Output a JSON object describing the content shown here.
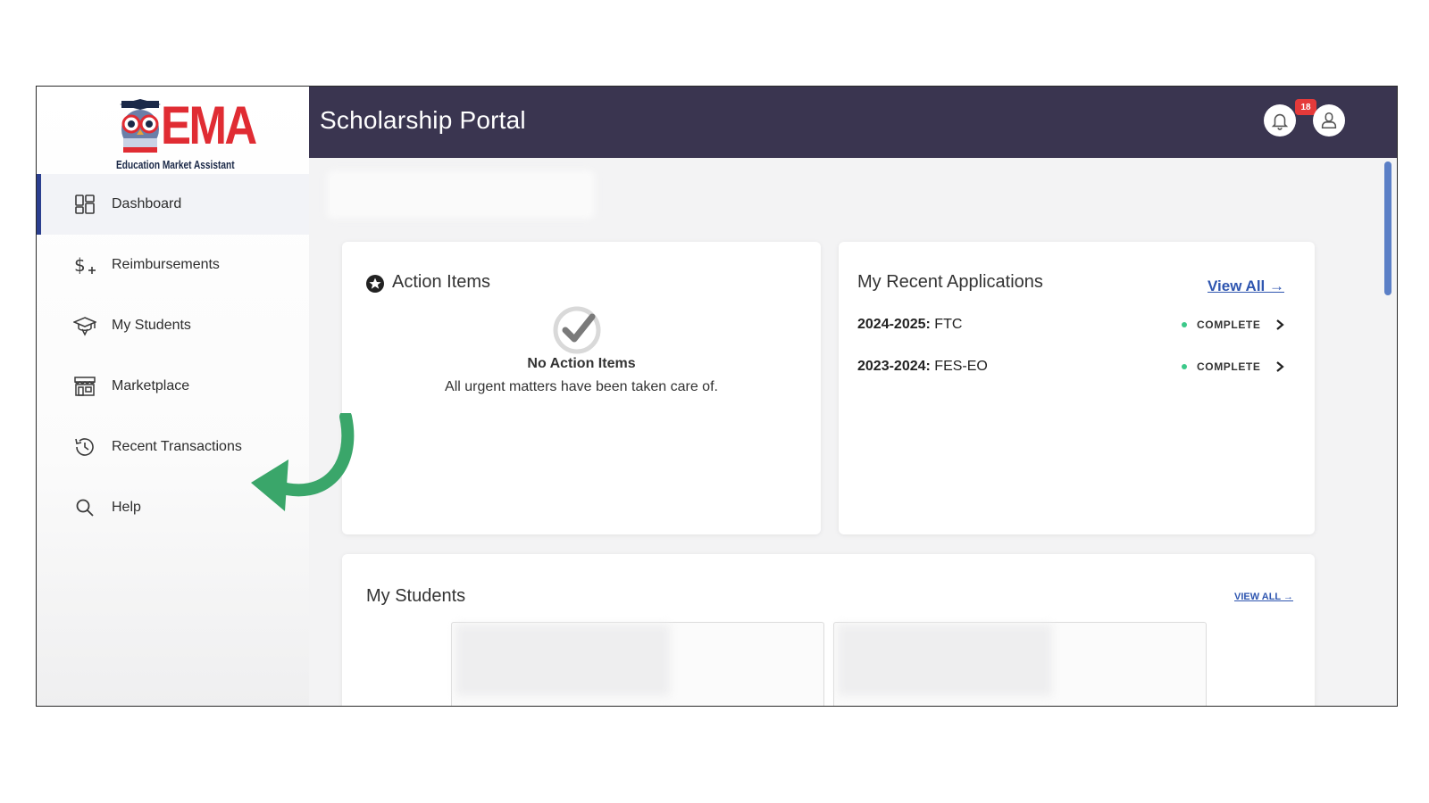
{
  "logo": {
    "letters": "EMA",
    "tagline": "Education Market Assistant"
  },
  "sidebar": {
    "items": [
      {
        "label": "Dashboard",
        "icon": "dashboard-grid-icon",
        "active": true
      },
      {
        "label": "Reimbursements",
        "icon": "dollar-plus-icon",
        "active": false
      },
      {
        "label": "My Students",
        "icon": "graduation-cap-icon",
        "active": false
      },
      {
        "label": "Marketplace",
        "icon": "storefront-icon",
        "active": false
      },
      {
        "label": "Recent Transactions",
        "icon": "history-clock-icon",
        "active": false
      },
      {
        "label": "Help",
        "icon": "search-icon",
        "active": false
      }
    ]
  },
  "header": {
    "title": "Scholarship Portal",
    "notification_count": "18"
  },
  "action_items": {
    "title": "Action Items",
    "empty_heading": "No Action Items",
    "empty_message": "All urgent matters have been taken care of."
  },
  "recent_applications": {
    "title": "My Recent Applications",
    "view_all": "View All →",
    "rows": [
      {
        "year": "2024-2025:",
        "program": " FTC",
        "status": "COMPLETE"
      },
      {
        "year": "2023-2024:",
        "program": " FES-EO",
        "status": "COMPLETE"
      }
    ]
  },
  "my_students": {
    "title": "My Students",
    "view_all": "VIEW ALL →"
  },
  "colors": {
    "header_bg": "#3a3550",
    "brand_red": "#e02c33",
    "link_blue": "#2f56b0",
    "active_border": "#2b3f8f",
    "status_green": "#3cc98a",
    "badge_red": "#e53a3a",
    "annotation_green": "#3aa66a"
  }
}
